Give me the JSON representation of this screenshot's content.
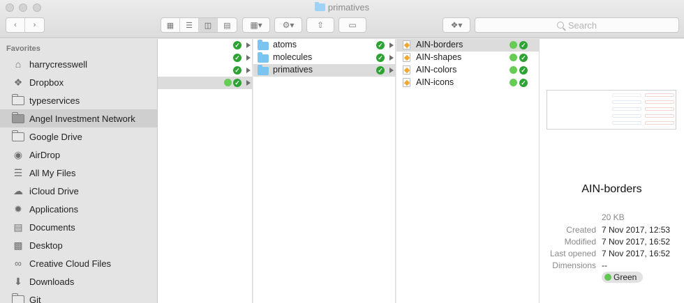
{
  "window": {
    "title": "primatives"
  },
  "search": {
    "placeholder": "Search"
  },
  "sidebar": {
    "heading": "Favorites",
    "items": [
      {
        "label": "harrycresswell",
        "icon": "home-icon"
      },
      {
        "label": "Dropbox",
        "icon": "dropbox-icon"
      },
      {
        "label": "typeservices",
        "icon": "folder-icon"
      },
      {
        "label": "Angel Investment Network",
        "icon": "folder-icon",
        "selected": true
      },
      {
        "label": "Google Drive",
        "icon": "folder-icon"
      },
      {
        "label": "AirDrop",
        "icon": "airdrop-icon"
      },
      {
        "label": "All My Files",
        "icon": "all-files-icon"
      },
      {
        "label": "iCloud Drive",
        "icon": "cloud-icon"
      },
      {
        "label": "Applications",
        "icon": "applications-icon"
      },
      {
        "label": "Documents",
        "icon": "documents-icon"
      },
      {
        "label": "Desktop",
        "icon": "desktop-icon"
      },
      {
        "label": "Creative Cloud Files",
        "icon": "creative-cloud-icon"
      },
      {
        "label": "Downloads",
        "icon": "downloads-icon"
      },
      {
        "label": "Git",
        "icon": "folder-icon"
      }
    ]
  },
  "column2": {
    "items": [
      {
        "label": "atoms"
      },
      {
        "label": "molecules"
      },
      {
        "label": "primatives",
        "selected": true
      }
    ]
  },
  "column3": {
    "items": [
      {
        "label": "AIN-borders",
        "selected": true
      },
      {
        "label": "AIN-shapes"
      },
      {
        "label": "AIN-colors"
      },
      {
        "label": "AIN-icons"
      }
    ]
  },
  "preview": {
    "title": "AIN-borders",
    "size": "20 KB",
    "created_label": "Created",
    "created": "7 Nov 2017, 12:53",
    "modified_label": "Modified",
    "modified": "7 Nov 2017, 16:52",
    "opened_label": "Last opened",
    "opened": "7 Nov 2017, 16:52",
    "dimensions_label": "Dimensions",
    "dimensions": "--",
    "tag": "Green"
  },
  "colors": {
    "sync_check": "#2ca332",
    "tag_green": "#62c554",
    "folder_blue": "#7cc4f0"
  }
}
